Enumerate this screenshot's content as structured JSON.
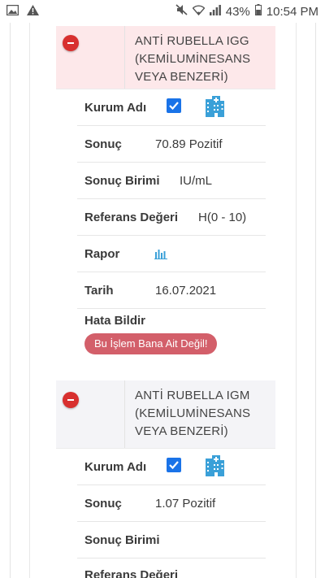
{
  "status_bar": {
    "battery": "43%",
    "time": "10:54 PM"
  },
  "records": [
    {
      "title": "ANTİ RUBELLA IGG (KEMİLUMİNESANS VEYA BENZERİ)",
      "kurum_label": "Kurum Adı",
      "sonuc_label": "Sonuç",
      "sonuc_value": "70.89 Pozitif",
      "birim_label": "Sonuç Birimi",
      "birim_value": "IU/mL",
      "referans_label": "Referans Değeri",
      "referans_value": "H(0 - 10)",
      "rapor_label": "Rapor",
      "tarih_label": "Tarih",
      "tarih_value": "16.07.2021",
      "hata_label": "Hata Bildir",
      "hata_button": "Bu İşlem Bana Ait Değil!"
    },
    {
      "title": "ANTİ RUBELLA IGM (KEMİLUMİNESANS VEYA BENZERİ)",
      "kurum_label": "Kurum Adı",
      "sonuc_label": "Sonuç",
      "sonuc_value": "1.07 Pozitif",
      "birim_label": "Sonuç Birimi",
      "birim_value": "",
      "referans_label": "Referans Değeri"
    }
  ],
  "colors": {
    "header_pink": "#fde8ea",
    "header_gray": "#f4f4f7",
    "remove_red": "#d8302f",
    "checkbox_blue": "#1a73e8",
    "building_blue": "#3aa0d8",
    "error_button": "#d35f6a"
  }
}
